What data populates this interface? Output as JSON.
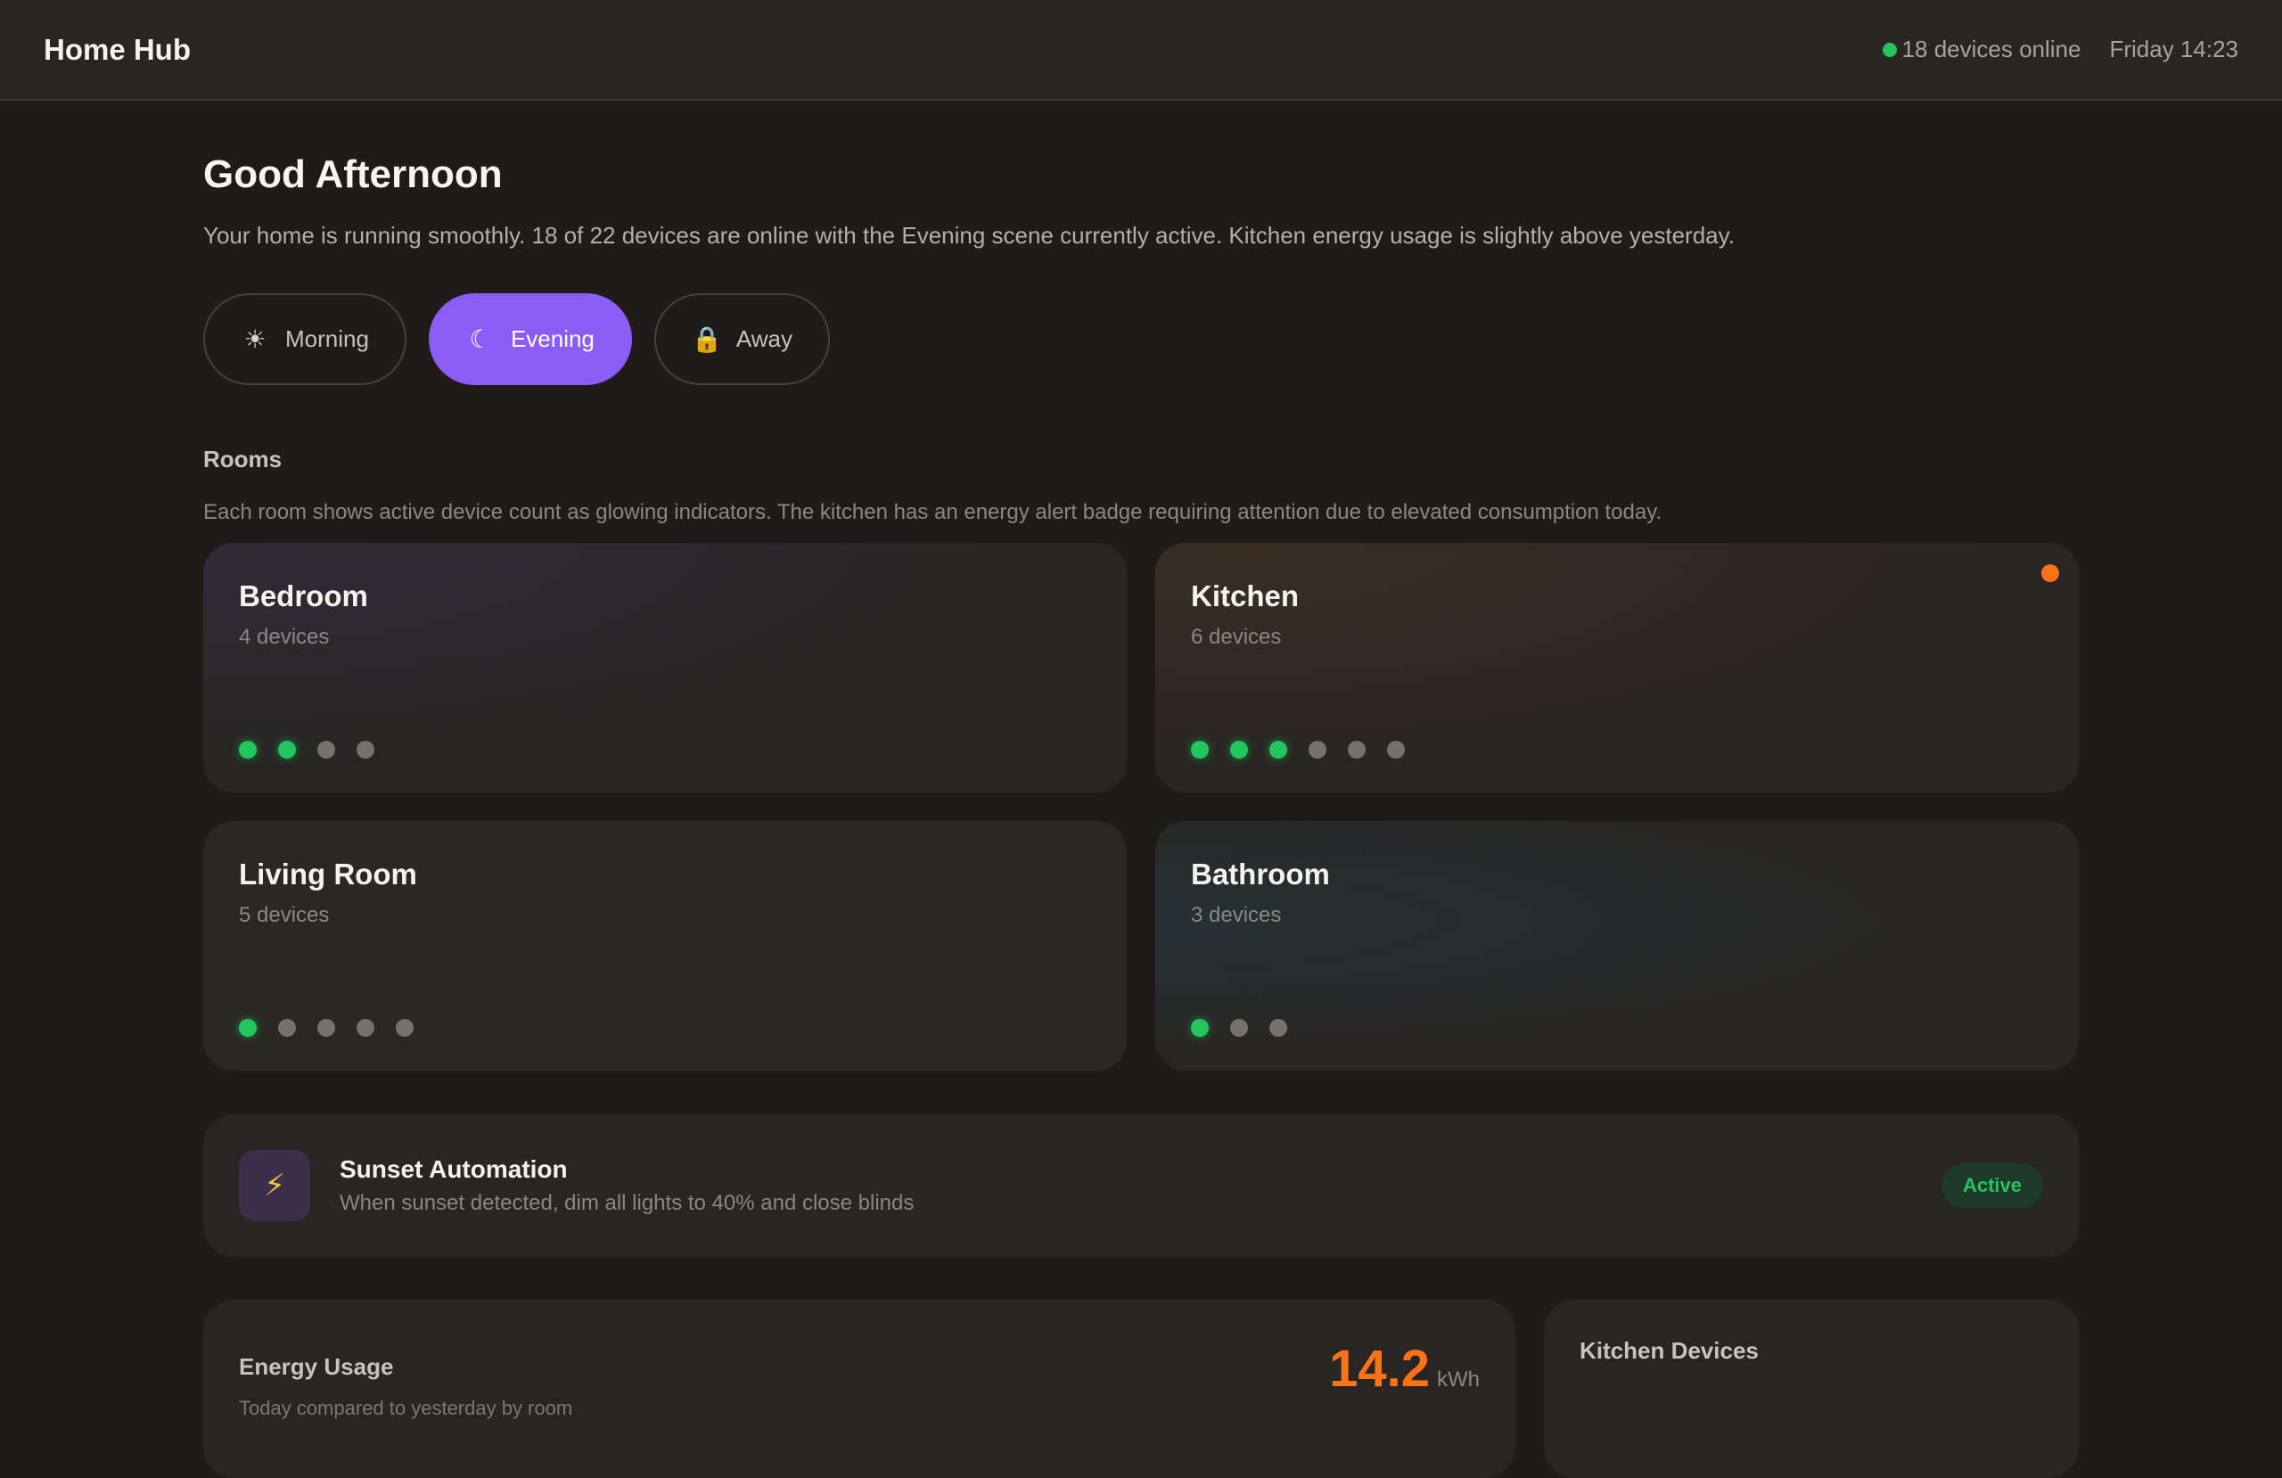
{
  "header": {
    "app_title": "Home Hub",
    "online_status": "18 devices online",
    "datetime": "Friday 14:23"
  },
  "greeting": {
    "title": "Good Afternoon",
    "summary": "Your home is running smoothly. 18 of 22 devices are online with the Evening scene currently active. Kitchen energy usage is slightly above yesterday."
  },
  "scenes": [
    {
      "label": "Morning",
      "icon": "sun-icon",
      "active": false
    },
    {
      "label": "Evening",
      "icon": "moon-icon",
      "active": true
    },
    {
      "label": "Away",
      "icon": "lock-icon",
      "active": false
    }
  ],
  "rooms_section": {
    "title": "Rooms",
    "description": "Each room shows active device count as glowing indicators. The kitchen has an energy alert badge requiring attention due to elevated consumption today."
  },
  "rooms": [
    {
      "name": "Bedroom",
      "count": "4 devices",
      "active": 2,
      "total": 4,
      "alert": false
    },
    {
      "name": "Kitchen",
      "count": "6 devices",
      "active": 3,
      "total": 6,
      "alert": true
    },
    {
      "name": "Living Room",
      "count": "5 devices",
      "active": 1,
      "total": 5,
      "alert": false
    },
    {
      "name": "Bathroom",
      "count": "3 devices",
      "active": 1,
      "total": 3,
      "alert": false
    }
  ],
  "automation": {
    "icon": "lightning-icon",
    "title": "Sunset Automation",
    "description": "When sunset detected, dim all lights to 40% and close blinds",
    "status": "Active"
  },
  "energy": {
    "title": "Energy Usage",
    "subtitle": "Today compared to yesterday by room",
    "value": "14.2",
    "unit": "kWh"
  },
  "kitchen_devices": {
    "title": "Kitchen Devices"
  },
  "colors": {
    "accent": "#8b5cf6",
    "online": "#22c55e",
    "alert": "#f97316",
    "background": "#1e1b19",
    "card": "#282523"
  }
}
